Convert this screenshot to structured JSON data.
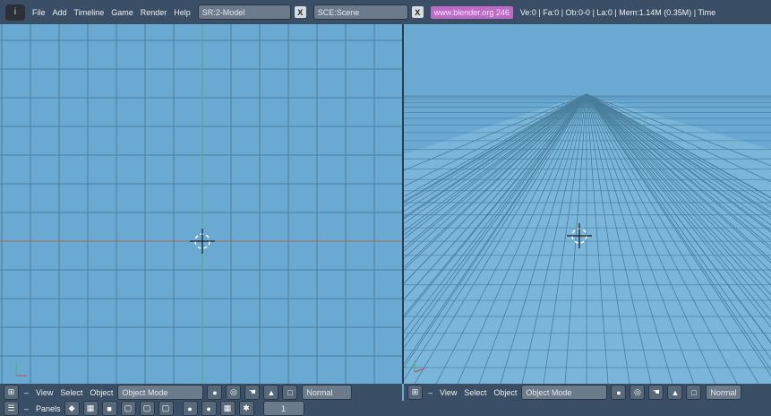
{
  "topbar": {
    "menus": [
      "File",
      "Add",
      "Timeline",
      "Game",
      "Render",
      "Help"
    ],
    "screen_field": "SR:2-Model",
    "scene_field": "SCE:Scene",
    "close_glyph": "X",
    "url": "www.blender.org 246",
    "stats": "Ve:0 | Fa:0 | Ob:0-0 | La:0  | Mem:1.14M (0.35M)  | Time"
  },
  "left_view": {
    "menus": [
      "View",
      "Select",
      "Object"
    ],
    "mode": "Object Mode",
    "shading": "Normal"
  },
  "right_view": {
    "menus": [
      "View",
      "Select",
      "Object"
    ],
    "mode": "Object Mode",
    "shading": "Normal"
  },
  "bottom": {
    "panels_label": "Panels",
    "frame": "1"
  },
  "colors": {
    "viewport_bg": "#6aaad2",
    "grid": "#4a7e9e",
    "axis_green": "#58b36a",
    "axis_red": "#b06060",
    "header_bg": "#3a4f66"
  },
  "icons": {
    "logo": "blender-logo-icon",
    "cursor": "3d-cursor-icon",
    "axis": "axis-gizmo-icon"
  }
}
